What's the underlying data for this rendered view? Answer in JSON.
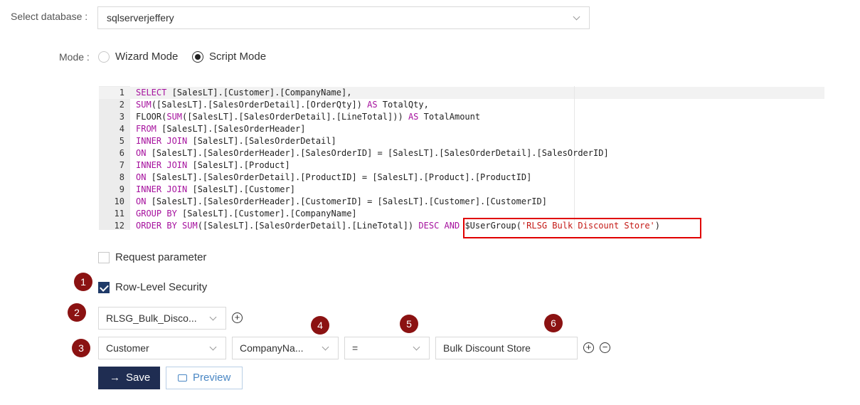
{
  "database": {
    "label": "Select database :",
    "value": "sqlserverjeffery"
  },
  "mode": {
    "label": "Mode :",
    "options": [
      "Wizard Mode",
      "Script Mode"
    ],
    "selected": "Script Mode"
  },
  "editor": {
    "line_numbers": [
      "1",
      "2",
      "3",
      "4",
      "5",
      "6",
      "7",
      "8",
      "9",
      "10",
      "11",
      "12"
    ],
    "lines": [
      [
        {
          "t": "SELECT",
          "k": "kw"
        },
        {
          "t": " [SalesLT].[Customer].[CompanyName],",
          "k": ""
        }
      ],
      [
        {
          "t": "SUM",
          "k": "kw"
        },
        {
          "t": "([SalesLT].[SalesOrderDetail].[OrderQty]) ",
          "k": ""
        },
        {
          "t": "AS",
          "k": "kw"
        },
        {
          "t": " TotalQty,",
          "k": ""
        }
      ],
      [
        {
          "t": "FLOOR",
          "k": ""
        },
        {
          "t": "(",
          "k": ""
        },
        {
          "t": "SUM",
          "k": "kw"
        },
        {
          "t": "([SalesLT].[SalesOrderDetail].[LineTotal])) ",
          "k": ""
        },
        {
          "t": "AS",
          "k": "kw"
        },
        {
          "t": " TotalAmount",
          "k": ""
        }
      ],
      [
        {
          "t": "FROM",
          "k": "kw"
        },
        {
          "t": " [SalesLT].[SalesOrderHeader]",
          "k": ""
        }
      ],
      [
        {
          "t": "INNER JOIN",
          "k": "kw"
        },
        {
          "t": " [SalesLT].[SalesOrderDetail]",
          "k": ""
        }
      ],
      [
        {
          "t": "ON",
          "k": "kw"
        },
        {
          "t": " [SalesLT].[SalesOrderHeader].[SalesOrderID] = [SalesLT].[SalesOrderDetail].[SalesOrderID]",
          "k": ""
        }
      ],
      [
        {
          "t": "INNER JOIN",
          "k": "kw"
        },
        {
          "t": " [SalesLT].[Product]",
          "k": ""
        }
      ],
      [
        {
          "t": "ON",
          "k": "kw"
        },
        {
          "t": " [SalesLT].[SalesOrderDetail].[ProductID] = [SalesLT].[Product].[ProductID]",
          "k": ""
        }
      ],
      [
        {
          "t": "INNER JOIN",
          "k": "kw"
        },
        {
          "t": " [SalesLT].[Customer]",
          "k": ""
        }
      ],
      [
        {
          "t": "ON",
          "k": "kw"
        },
        {
          "t": " [SalesLT].[SalesOrderHeader].[CustomerID] = [SalesLT].[Customer].[CustomerID]",
          "k": ""
        }
      ],
      [
        {
          "t": "GROUP BY",
          "k": "kw"
        },
        {
          "t": " [SalesLT].[Customer].[CompanyName]",
          "k": ""
        }
      ],
      [
        {
          "t": "ORDER BY",
          "k": "kw"
        },
        {
          "t": " ",
          "k": ""
        },
        {
          "t": "SUM",
          "k": "kw"
        },
        {
          "t": "([SalesLT].[SalesOrderDetail].[LineTotal]) ",
          "k": ""
        },
        {
          "t": "DESC",
          "k": "kw"
        },
        {
          "t": " ",
          "k": ""
        },
        {
          "t": "AND",
          "k": "kw"
        },
        {
          "t": " $UserGroup(",
          "k": ""
        },
        {
          "t": "'RLSG Bulk Discount Store'",
          "k": "str"
        },
        {
          "t": ")",
          "k": ""
        }
      ]
    ]
  },
  "request_parameter": {
    "label": "Request parameter",
    "checked": false
  },
  "row_level_security": {
    "label": "Row-Level Security",
    "checked": true
  },
  "badges": [
    "1",
    "2",
    "3",
    "4",
    "5",
    "6"
  ],
  "rls": {
    "group_select": "RLSG_Bulk_Disco...",
    "table_select": "Customer",
    "column_select": "CompanyNa...",
    "operator_select": "=",
    "value": "Bulk Discount Store"
  },
  "buttons": {
    "save": "Save",
    "preview": "Preview"
  },
  "colors": {
    "primary": "#1f2d52",
    "badge": "#8b1212",
    "highlight_box": "#e00000",
    "keyword": "#a6129e",
    "string": "#c41a16",
    "link": "#4a87c4"
  }
}
